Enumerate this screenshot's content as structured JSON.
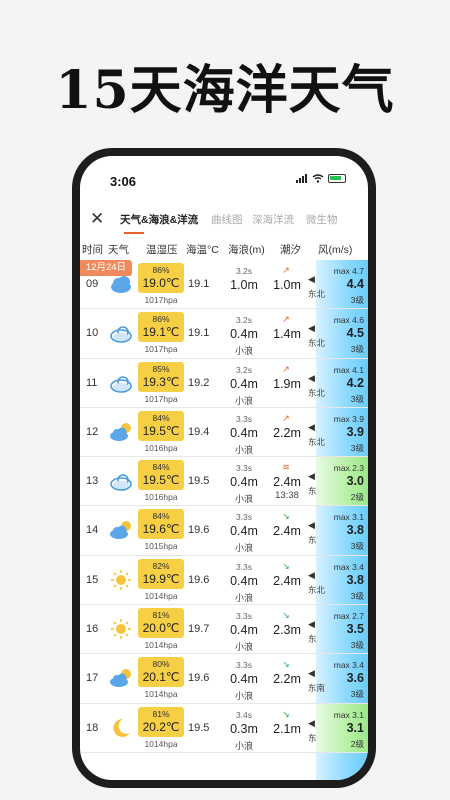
{
  "headline": "15天海洋天气",
  "status": {
    "time": "3:06"
  },
  "tabs": [
    {
      "label": "天气&海浪&洋流",
      "active": true
    },
    {
      "label": "曲线图",
      "active": false
    },
    {
      "label": "深海洋流",
      "active": false
    },
    {
      "label": "微生物",
      "active": false
    }
  ],
  "columns": {
    "time": "时间",
    "weather": "天气",
    "temp": "温湿压",
    "sst": "海温°C",
    "wave": "海浪(m)",
    "tide": "潮汐",
    "wind": "风(m/s)"
  },
  "date_badge": "12月24日",
  "colors": {
    "accent": "#e9622b",
    "temp_box": "#f7cf44",
    "tide_rise": "#e9622b",
    "tide_fall": "#2db04c"
  },
  "rows": [
    {
      "hour": "09",
      "icon": "cloudy-icon",
      "humidity": "86%",
      "temp": "19.0℃",
      "pressure": "1017hpa",
      "sst": "19.1",
      "period": "3.2s",
      "wave": "1.0m",
      "wave_desc": "",
      "tide_dir": "rise",
      "tide_arrow": "↗",
      "tide": "1.0m",
      "tide_time": "",
      "wind_dir": "东北",
      "wind_max": "max 4.7",
      "wind_speed": "4.4",
      "wind_level": "3级",
      "green": false
    },
    {
      "hour": "10",
      "icon": "cloud-icon",
      "humidity": "86%",
      "temp": "19.1℃",
      "pressure": "1017hpa",
      "sst": "19.1",
      "period": "3.2s",
      "wave": "0.4m",
      "wave_desc": "小浪",
      "tide_dir": "rise",
      "tide_arrow": "↗",
      "tide": "1.4m",
      "tide_time": "",
      "wind_dir": "东北",
      "wind_max": "max 4.6",
      "wind_speed": "4.5",
      "wind_level": "3级",
      "green": false
    },
    {
      "hour": "11",
      "icon": "cloud-icon",
      "humidity": "85%",
      "temp": "19.3℃",
      "pressure": "1017hpa",
      "sst": "19.2",
      "period": "3.2s",
      "wave": "0.4m",
      "wave_desc": "小浪",
      "tide_dir": "rise",
      "tide_arrow": "↗",
      "tide": "1.9m",
      "tide_time": "",
      "wind_dir": "东北",
      "wind_max": "max 4.1",
      "wind_speed": "4.2",
      "wind_level": "3级",
      "green": false
    },
    {
      "hour": "12",
      "icon": "partly-cloudy-icon",
      "humidity": "84%",
      "temp": "19.5℃",
      "pressure": "1016hpa",
      "sst": "19.4",
      "period": "3.3s",
      "wave": "0.4m",
      "wave_desc": "小浪",
      "tide_dir": "rise",
      "tide_arrow": "↗",
      "tide": "2.2m",
      "tide_time": "",
      "wind_dir": "东北",
      "wind_max": "max 3.9",
      "wind_speed": "3.9",
      "wind_level": "3级",
      "green": false
    },
    {
      "hour": "13",
      "icon": "cloud-icon",
      "humidity": "84%",
      "temp": "19.5℃",
      "pressure": "1016hpa",
      "sst": "19.5",
      "period": "3.3s",
      "wave": "0.4m",
      "wave_desc": "小浪",
      "tide_dir": "peak",
      "tide_arrow": "≋",
      "tide": "2.4m",
      "tide_time": "13:38",
      "wind_dir": "东",
      "wind_max": "max 2.3",
      "wind_speed": "3.0",
      "wind_level": "2级",
      "green": true
    },
    {
      "hour": "14",
      "icon": "partly-cloudy-icon",
      "humidity": "84%",
      "temp": "19.6℃",
      "pressure": "1015hpa",
      "sst": "19.6",
      "period": "3.3s",
      "wave": "0.4m",
      "wave_desc": "小浪",
      "tide_dir": "fall",
      "tide_arrow": "↘",
      "tide": "2.4m",
      "tide_time": "",
      "wind_dir": "东",
      "wind_max": "max 3.1",
      "wind_speed": "3.8",
      "wind_level": "3级",
      "green": false
    },
    {
      "hour": "15",
      "icon": "sun-icon",
      "humidity": "82%",
      "temp": "19.9℃",
      "pressure": "1014hpa",
      "sst": "19.6",
      "period": "3.3s",
      "wave": "0.4m",
      "wave_desc": "小浪",
      "tide_dir": "fall",
      "tide_arrow": "↘",
      "tide": "2.4m",
      "tide_time": "",
      "wind_dir": "东北",
      "wind_max": "max 3.4",
      "wind_speed": "3.8",
      "wind_level": "3级",
      "green": false
    },
    {
      "hour": "16",
      "icon": "sun-icon",
      "humidity": "81%",
      "temp": "20.0℃",
      "pressure": "1014hpa",
      "sst": "19.7",
      "period": "3.3s",
      "wave": "0.4m",
      "wave_desc": "小浪",
      "tide_dir": "fall",
      "tide_arrow": "↘",
      "tide": "2.3m",
      "tide_time": "",
      "wind_dir": "东",
      "wind_max": "max 2.7",
      "wind_speed": "3.5",
      "wind_level": "3级",
      "green": false
    },
    {
      "hour": "17",
      "icon": "partly-cloudy-icon",
      "humidity": "80%",
      "temp": "20.1℃",
      "pressure": "1014hpa",
      "sst": "19.6",
      "period": "3.3s",
      "wave": "0.4m",
      "wave_desc": "小浪",
      "tide_dir": "fall",
      "tide_arrow": "↘",
      "tide": "2.2m",
      "tide_time": "",
      "wind_dir": "东南",
      "wind_max": "max 3.4",
      "wind_speed": "3.6",
      "wind_level": "3级",
      "green": false
    },
    {
      "hour": "18",
      "icon": "moon-icon",
      "humidity": "81%",
      "temp": "20.2℃",
      "pressure": "1014hpa",
      "sst": "19.5",
      "period": "3.4s",
      "wave": "0.3m",
      "wave_desc": "小浪",
      "tide_dir": "fall",
      "tide_arrow": "↘",
      "tide": "2.1m",
      "tide_time": "",
      "wind_dir": "东",
      "wind_max": "max 3.1",
      "wind_speed": "3.1",
      "wind_level": "2级",
      "green": true
    }
  ]
}
